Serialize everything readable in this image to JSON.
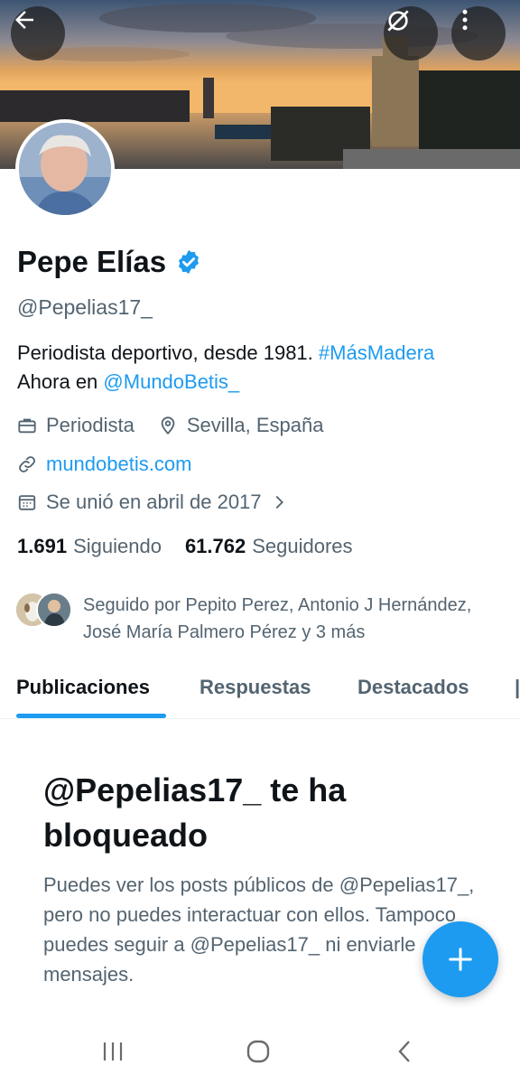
{
  "profile": {
    "name": "Pepe Elías",
    "handle": "@Pepelias17_",
    "bio_text": "Periodista deportivo, desde 1981.",
    "bio_hashtag": "#MásMadera",
    "bio_line2_prefix": "Ahora en",
    "bio_mention": "@MundoBetis_",
    "profession": "Periodista",
    "location": "Sevilla, España",
    "website": "mundobetis.com",
    "joined": "Se unió en abril de 2017",
    "following_count": "1.691",
    "following_label": "Siguiendo",
    "followers_count": "61.762",
    "followers_label": "Seguidores",
    "followed_by": "Seguido por Pepito Perez, Antonio J Hernández, José María Palmero Pérez y 3 más"
  },
  "tabs": [
    {
      "label": "Publicaciones",
      "active": true
    },
    {
      "label": "Respuestas",
      "active": false
    },
    {
      "label": "Destacados",
      "active": false
    }
  ],
  "blocked": {
    "title": "@Pepelias17_ te ha bloqueado",
    "description": "Puedes ver los posts públicos de @Pepelias17_, pero no puedes interactuar con ellos. Tampoco puedes seguir a @Pepelias17_ ni enviarle mensajes."
  },
  "icons": {
    "back": "arrow-left-icon",
    "circle": "no-circle-icon",
    "more": "more-vertical-icon",
    "verified": "verified-badge-icon",
    "profession": "briefcase-icon",
    "location": "location-pin-icon",
    "website": "link-icon",
    "joined": "calendar-icon",
    "compose": "plus-icon"
  },
  "colors": {
    "accent": "#1d9bf0",
    "text_primary": "#0f1419",
    "text_secondary": "#536471"
  }
}
